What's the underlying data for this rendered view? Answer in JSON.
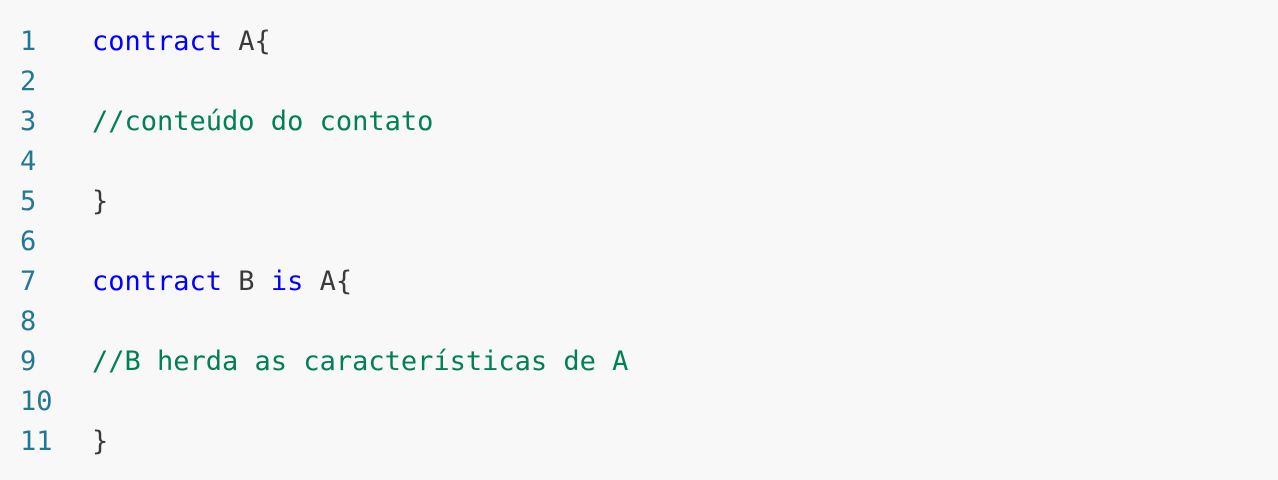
{
  "code_lines": [
    {
      "number": "1",
      "tokens": [
        {
          "type": "keyword",
          "text": "contract"
        },
        {
          "type": "plain",
          "text": " A{"
        }
      ]
    },
    {
      "number": "2",
      "tokens": []
    },
    {
      "number": "3",
      "tokens": [
        {
          "type": "comment",
          "text": "//conteúdo do contato"
        }
      ]
    },
    {
      "number": "4",
      "tokens": []
    },
    {
      "number": "5",
      "tokens": [
        {
          "type": "plain",
          "text": "}"
        }
      ]
    },
    {
      "number": "6",
      "tokens": []
    },
    {
      "number": "7",
      "tokens": [
        {
          "type": "keyword",
          "text": "contract"
        },
        {
          "type": "plain",
          "text": " B "
        },
        {
          "type": "keyword",
          "text": "is"
        },
        {
          "type": "plain",
          "text": " A{"
        }
      ]
    },
    {
      "number": "8",
      "tokens": []
    },
    {
      "number": "9",
      "tokens": [
        {
          "type": "comment",
          "text": "//B herda as características de A"
        }
      ]
    },
    {
      "number": "10",
      "tokens": []
    },
    {
      "number": "11",
      "tokens": [
        {
          "type": "plain",
          "text": "}"
        }
      ]
    }
  ],
  "colors": {
    "background": "#f8f8f8",
    "line_number": "#237893",
    "keyword": "#0000ff",
    "comment": "#008054",
    "plain": "#3b3b3b"
  }
}
